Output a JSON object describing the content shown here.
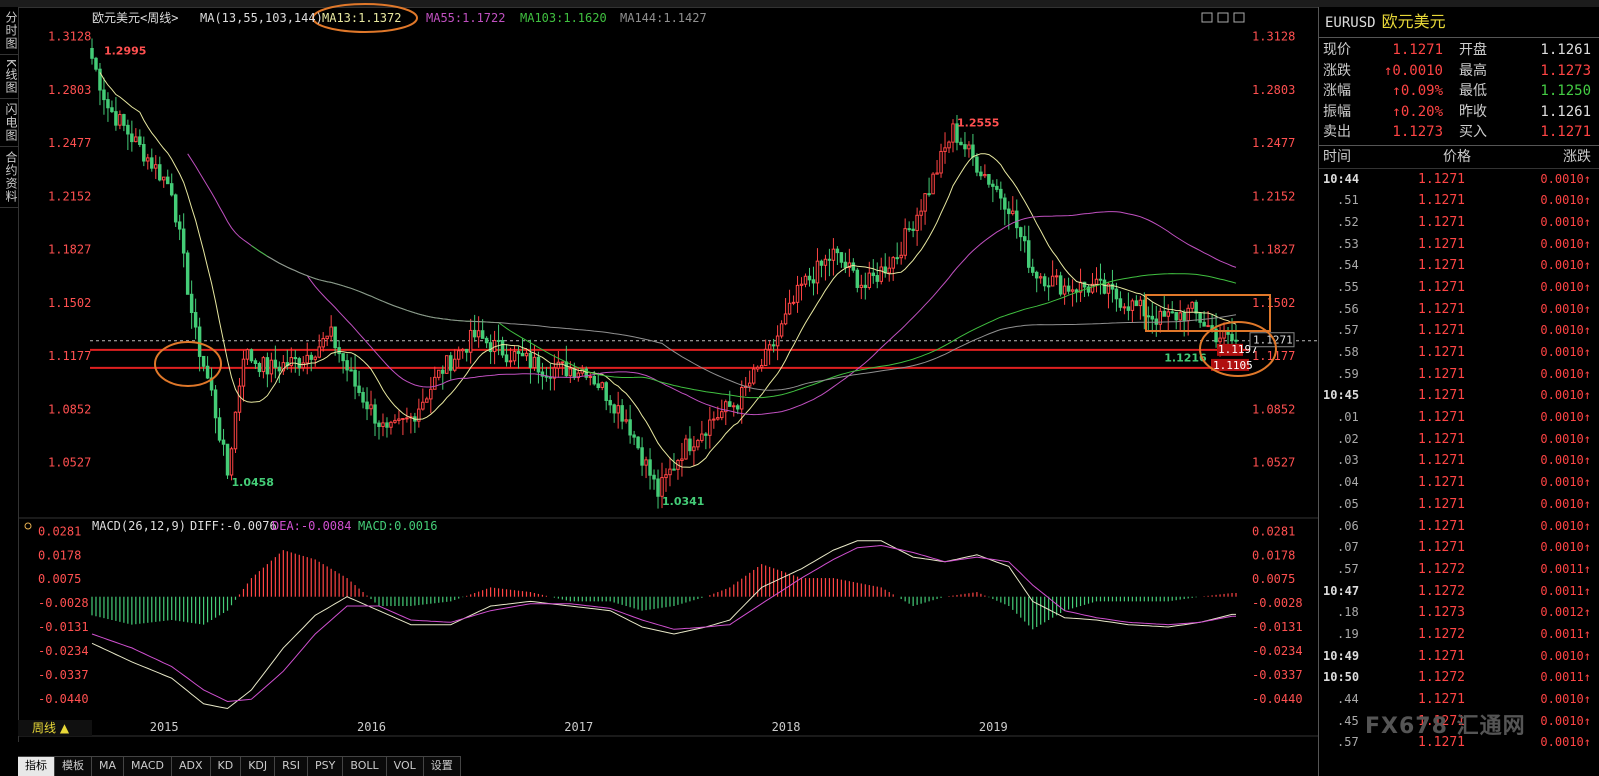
{
  "left_tabs": [
    "分时图",
    "K线图",
    "闪电图",
    "合约资料"
  ],
  "header": {
    "title": "欧元美元<周线>",
    "ma_prefix": "MA(13,55,103,144)",
    "ma13": "MA13:1.1372",
    "ma55": "MA55:1.1722",
    "ma103": "MA103:1.1620",
    "ma144": "MA144:1.1427"
  },
  "macd_header": {
    "params": "MACD(26,12,9)",
    "diff": "DIFF:-0.0076",
    "dea": "DEA:-0.0084",
    "macd": "MACD:0.0016"
  },
  "colors": {
    "up": "#ff4444",
    "down": "#44cc77",
    "ma13": "#e8e8a0",
    "ma55": "#c050c0",
    "ma103": "#40c040",
    "ma144": "#909090",
    "diff": "#e8e8c8",
    "dea": "#d050d0",
    "annot": "#e0782a",
    "level": "#e02020"
  },
  "chart_data": [
    {
      "type": "candlestick",
      "title": "欧元美元<周线>",
      "x_ticks": [
        "2015",
        "2016",
        "2017",
        "2018",
        "2019"
      ],
      "y_ticks": [
        "1.3128",
        "1.2803",
        "1.2477",
        "1.2152",
        "1.1827",
        "1.1502",
        "1.1177",
        "1.0852",
        "1.0527"
      ],
      "ylim": [
        1.025,
        1.318
      ],
      "price_path": [
        [
          0,
          1.2995
        ],
        [
          4,
          1.27
        ],
        [
          12,
          1.245
        ],
        [
          20,
          1.22
        ],
        [
          26,
          1.13
        ],
        [
          30,
          1.095
        ],
        [
          34,
          1.0458
        ],
        [
          38,
          1.12
        ],
        [
          44,
          1.11
        ],
        [
          52,
          1.115
        ],
        [
          60,
          1.13
        ],
        [
          66,
          1.1
        ],
        [
          74,
          1.07
        ],
        [
          80,
          1.08
        ],
        [
          88,
          1.11
        ],
        [
          96,
          1.13
        ],
        [
          104,
          1.12
        ],
        [
          114,
          1.11
        ],
        [
          124,
          1.11
        ],
        [
          134,
          1.08
        ],
        [
          142,
          1.0341
        ],
        [
          148,
          1.06
        ],
        [
          156,
          1.08
        ],
        [
          162,
          1.09
        ],
        [
          170,
          1.12
        ],
        [
          178,
          1.16
        ],
        [
          186,
          1.18
        ],
        [
          194,
          1.16
        ],
        [
          202,
          1.18
        ],
        [
          210,
          1.22
        ],
        [
          216,
          1.2555
        ],
        [
          222,
          1.235
        ],
        [
          230,
          1.21
        ],
        [
          236,
          1.17
        ],
        [
          244,
          1.16
        ],
        [
          252,
          1.16
        ],
        [
          260,
          1.15
        ],
        [
          268,
          1.14
        ],
        [
          276,
          1.145
        ],
        [
          282,
          1.131
        ],
        [
          286,
          1.1271
        ]
      ],
      "current_price": "1.1271",
      "annotations": [
        "1.2995",
        "1.0458",
        "1.0341",
        "1.2555",
        "1.1216",
        "1.1197",
        "1.1105"
      ],
      "horizontal_levels": [
        1.1215,
        1.1105
      ],
      "moving_averages": [
        {
          "name": "MA13",
          "last": 1.1372
        },
        {
          "name": "MA55",
          "last": 1.1722
        },
        {
          "name": "MA103",
          "last": 1.162
        },
        {
          "name": "MA144",
          "last": 1.1427
        }
      ]
    },
    {
      "type": "line",
      "title": "MACD(26,12,9)",
      "y_ticks": [
        "0.0281",
        "0.0178",
        "0.0075",
        "-0.0028",
        "-0.0131",
        "-0.0234",
        "-0.0337",
        "-0.0440"
      ],
      "ylim": [
        -0.0495,
        0.0295
      ],
      "diff_path": [
        [
          0,
          -0.02
        ],
        [
          10,
          -0.028
        ],
        [
          20,
          -0.035
        ],
        [
          28,
          -0.046
        ],
        [
          34,
          -0.048
        ],
        [
          40,
          -0.04
        ],
        [
          48,
          -0.022
        ],
        [
          56,
          -0.008
        ],
        [
          64,
          0.0
        ],
        [
          72,
          -0.006
        ],
        [
          80,
          -0.012
        ],
        [
          90,
          -0.012
        ],
        [
          100,
          -0.004
        ],
        [
          110,
          -0.002
        ],
        [
          120,
          -0.004
        ],
        [
          130,
          -0.006
        ],
        [
          138,
          -0.013
        ],
        [
          146,
          -0.016
        ],
        [
          154,
          -0.013
        ],
        [
          160,
          -0.01
        ],
        [
          168,
          0.004
        ],
        [
          178,
          0.012
        ],
        [
          186,
          0.02
        ],
        [
          192,
          0.024
        ],
        [
          198,
          0.024
        ],
        [
          206,
          0.017
        ],
        [
          214,
          0.015
        ],
        [
          222,
          0.018
        ],
        [
          230,
          0.013
        ],
        [
          236,
          -0.002
        ],
        [
          244,
          -0.009
        ],
        [
          252,
          -0.01
        ],
        [
          260,
          -0.012
        ],
        [
          270,
          -0.013
        ],
        [
          278,
          -0.011
        ],
        [
          286,
          -0.0076
        ]
      ],
      "dea_path": [
        [
          0,
          -0.016
        ],
        [
          10,
          -0.022
        ],
        [
          20,
          -0.03
        ],
        [
          28,
          -0.04
        ],
        [
          34,
          -0.045
        ],
        [
          40,
          -0.044
        ],
        [
          48,
          -0.032
        ],
        [
          56,
          -0.016
        ],
        [
          64,
          -0.004
        ],
        [
          72,
          -0.004
        ],
        [
          80,
          -0.01
        ],
        [
          90,
          -0.011
        ],
        [
          100,
          -0.006
        ],
        [
          110,
          -0.003
        ],
        [
          120,
          -0.003
        ],
        [
          130,
          -0.005
        ],
        [
          138,
          -0.01
        ],
        [
          146,
          -0.014
        ],
        [
          154,
          -0.013
        ],
        [
          160,
          -0.012
        ],
        [
          168,
          -0.003
        ],
        [
          178,
          0.008
        ],
        [
          186,
          0.016
        ],
        [
          192,
          0.021
        ],
        [
          198,
          0.022
        ],
        [
          206,
          0.019
        ],
        [
          214,
          0.015
        ],
        [
          222,
          0.017
        ],
        [
          230,
          0.015
        ],
        [
          236,
          0.005
        ],
        [
          244,
          -0.006
        ],
        [
          252,
          -0.009
        ],
        [
          260,
          -0.011
        ],
        [
          270,
          -0.012
        ],
        [
          278,
          -0.011
        ],
        [
          286,
          -0.0084
        ]
      ]
    }
  ],
  "bottom": {
    "period": "周线",
    "tabs": [
      "指标",
      "模板",
      "MA",
      "MACD",
      "ADX",
      "KD",
      "KDJ",
      "RSI",
      "PSY",
      "BOLL",
      "VOL",
      "设置"
    ]
  },
  "panel": {
    "symbol": "EURUSD",
    "name": "欧元美元",
    "quote": [
      {
        "l": "现价",
        "v": "1.1271",
        "l2": "开盘",
        "v2": "1.1261"
      },
      {
        "l": "涨跌",
        "v": "↑0.0010",
        "l2": "最高",
        "v2": "1.1273"
      },
      {
        "l": "涨幅",
        "v": "↑0.09%",
        "l2": "最低",
        "v2": "1.1250"
      },
      {
        "l": "振幅",
        "v": "↑0.20%",
        "l2": "昨收",
        "v2": "1.1261"
      },
      {
        "l": "卖出",
        "v": "1.1273",
        "l2": "买入",
        "v2": "1.1271"
      }
    ],
    "columns": [
      "时间",
      "价格",
      "涨跌"
    ],
    "ticks": [
      {
        "t": "10:44",
        "p": "1.1271",
        "c": "0.0010↑"
      },
      {
        "t": ".51",
        "p": "1.1271",
        "c": "0.0010↑"
      },
      {
        "t": ".52",
        "p": "1.1271",
        "c": "0.0010↑"
      },
      {
        "t": ".53",
        "p": "1.1271",
        "c": "0.0010↑"
      },
      {
        "t": ".54",
        "p": "1.1271",
        "c": "0.0010↑"
      },
      {
        "t": ".55",
        "p": "1.1271",
        "c": "0.0010↑"
      },
      {
        "t": ".56",
        "p": "1.1271",
        "c": "0.0010↑"
      },
      {
        "t": ".57",
        "p": "1.1271",
        "c": "0.0010↑"
      },
      {
        "t": ".58",
        "p": "1.1271",
        "c": "0.0010↑"
      },
      {
        "t": ".59",
        "p": "1.1271",
        "c": "0.0010↑"
      },
      {
        "t": "10:45",
        "p": "1.1271",
        "c": "0.0010↑"
      },
      {
        "t": ".01",
        "p": "1.1271",
        "c": "0.0010↑"
      },
      {
        "t": ".02",
        "p": "1.1271",
        "c": "0.0010↑"
      },
      {
        "t": ".03",
        "p": "1.1271",
        "c": "0.0010↑"
      },
      {
        "t": ".04",
        "p": "1.1271",
        "c": "0.0010↑"
      },
      {
        "t": ".05",
        "p": "1.1271",
        "c": "0.0010↑"
      },
      {
        "t": ".06",
        "p": "1.1271",
        "c": "0.0010↑"
      },
      {
        "t": ".07",
        "p": "1.1271",
        "c": "0.0010↑"
      },
      {
        "t": ".57",
        "p": "1.1272",
        "c": "0.0011↑"
      },
      {
        "t": "10:47",
        "p": "1.1272",
        "c": "0.0011↑"
      },
      {
        "t": ".18",
        "p": "1.1273",
        "c": "0.0012↑"
      },
      {
        "t": ".19",
        "p": "1.1272",
        "c": "0.0011↑"
      },
      {
        "t": "10:49",
        "p": "1.1271",
        "c": "0.0010↑"
      },
      {
        "t": "10:50",
        "p": "1.1272",
        "c": "0.0011↑"
      },
      {
        "t": ".44",
        "p": "1.1271",
        "c": "0.0010↑"
      },
      {
        "t": ".45",
        "p": "1.1271",
        "c": "0.0010↑"
      },
      {
        "t": ".57",
        "p": "1.1271",
        "c": "0.0010↑"
      }
    ]
  },
  "watermark": "FX678 汇通网"
}
